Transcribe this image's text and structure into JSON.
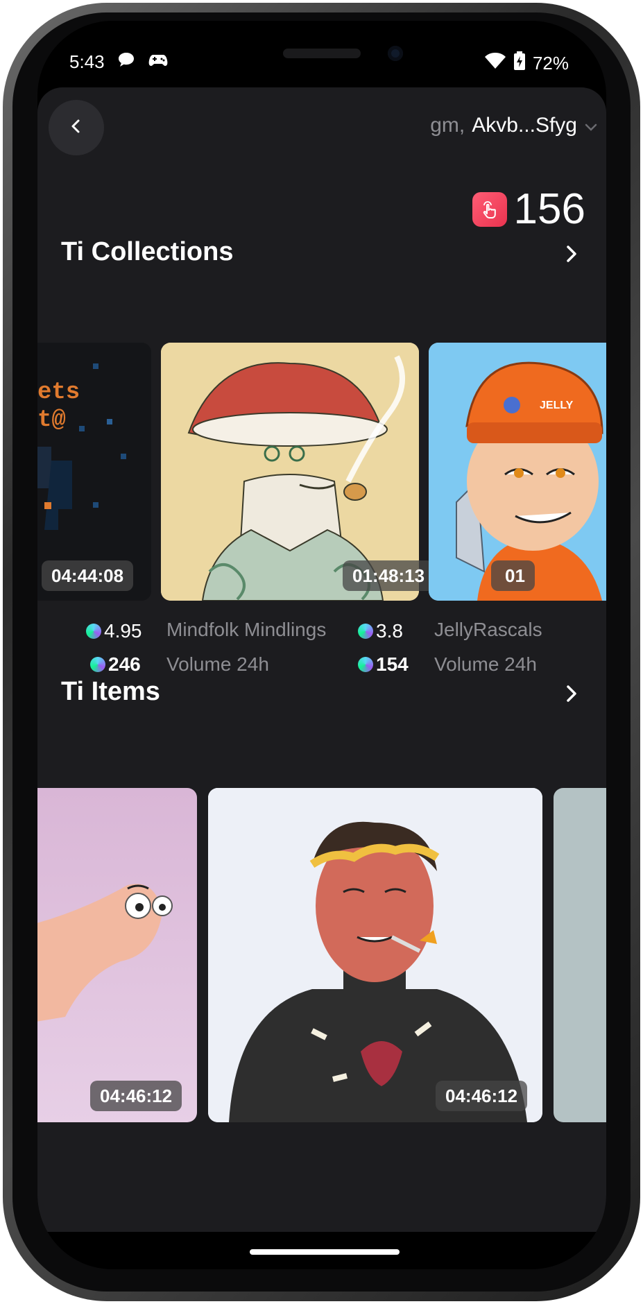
{
  "status_bar": {
    "time": "5:43",
    "battery": "72%"
  },
  "header": {
    "greeting_prefix": "gm,",
    "address": "Akvb...Sfyg"
  },
  "points": {
    "value": "156"
  },
  "collections": {
    "title": "Ti Collections",
    "items": [
      {
        "timer": "04:44:08",
        "price": "4.95",
        "volume": "246"
      },
      {
        "timer": "01:48:13",
        "name": "Mindfolk Mindlings",
        "volume_label": "Volume 24h",
        "price": "3.8",
        "volume": "154"
      },
      {
        "timer": "01",
        "name": "JellyRascals",
        "volume_label": "Volume 24h"
      }
    ]
  },
  "items": {
    "title": "Ti Items",
    "cards": [
      {
        "timer": "04:46:12"
      },
      {
        "timer": "04:46:12"
      }
    ]
  },
  "colors": {
    "app_bg": "#1c1c1f",
    "points_icon": "#ff5d75"
  }
}
